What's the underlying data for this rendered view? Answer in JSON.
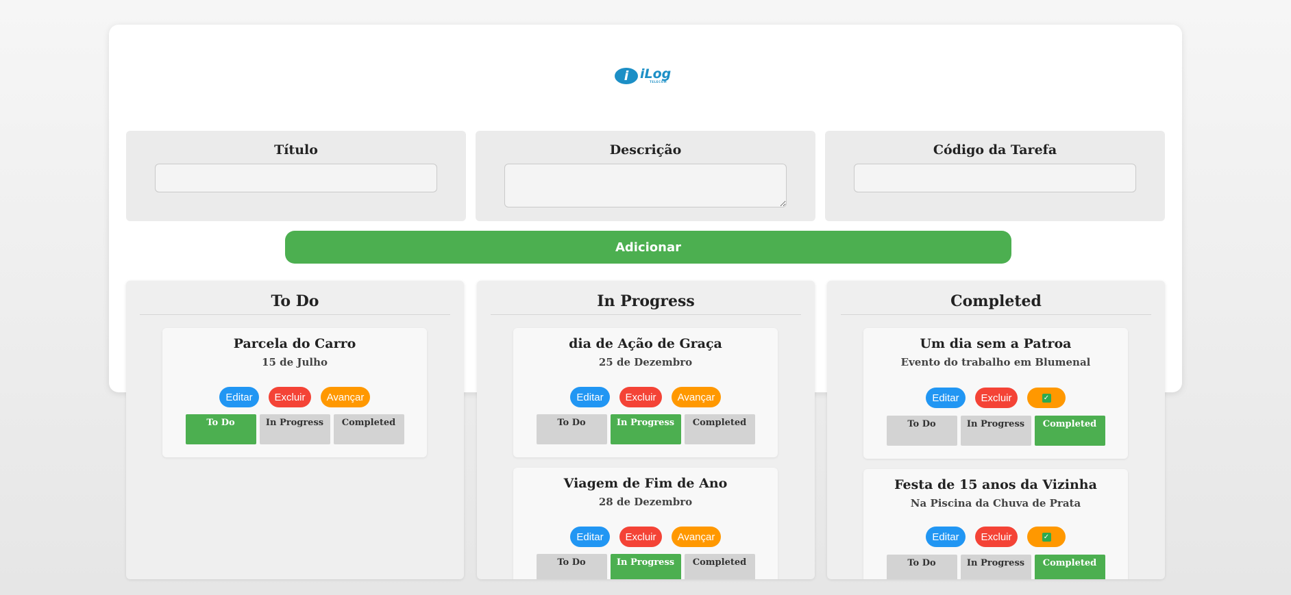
{
  "logo": {
    "mark": "i",
    "word": "iLog",
    "sub": "TELECOM"
  },
  "form": {
    "titulo_label": "Título",
    "descricao_label": "Descrição",
    "codigo_label": "Código da Tarefa",
    "titulo_value": "",
    "descricao_value": "",
    "codigo_value": "",
    "add_button": "Adicionar"
  },
  "labels": {
    "edit": "Editar",
    "delete": "Excluir",
    "advance": "Avançar",
    "status_todo": "To Do",
    "status_inprogress": "In Progress",
    "status_completed": "Completed"
  },
  "columns": {
    "todo": {
      "title": "To Do",
      "cards": [
        {
          "title": "Parcela do Carro",
          "subtitle": "15 de Julho",
          "status": "todo"
        }
      ]
    },
    "inprogress": {
      "title": "In Progress",
      "cards": [
        {
          "title": "dia de Ação de Graça",
          "subtitle": "25 de Dezembro",
          "status": "inprogress"
        },
        {
          "title": "Viagem de Fim de Ano",
          "subtitle": "28 de Dezembro",
          "status": "inprogress"
        }
      ]
    },
    "completed": {
      "title": "Completed",
      "cards": [
        {
          "title": "Um dia sem a Patroa",
          "subtitle": "Evento do trabalho em Blumenal",
          "status": "completed",
          "advance_icon": "check-icon"
        },
        {
          "title": "Festa de 15 anos da Vizinha",
          "subtitle": "Na Piscina da Chuva de Prata",
          "status": "completed",
          "advance_icon": "check-icon"
        }
      ]
    }
  },
  "colors": {
    "green": "#4caf50",
    "blue": "#2196f3",
    "red": "#f44336",
    "orange": "#ff9800",
    "status_idle": "#d3d3d3",
    "brand": "#1c8fc6"
  }
}
